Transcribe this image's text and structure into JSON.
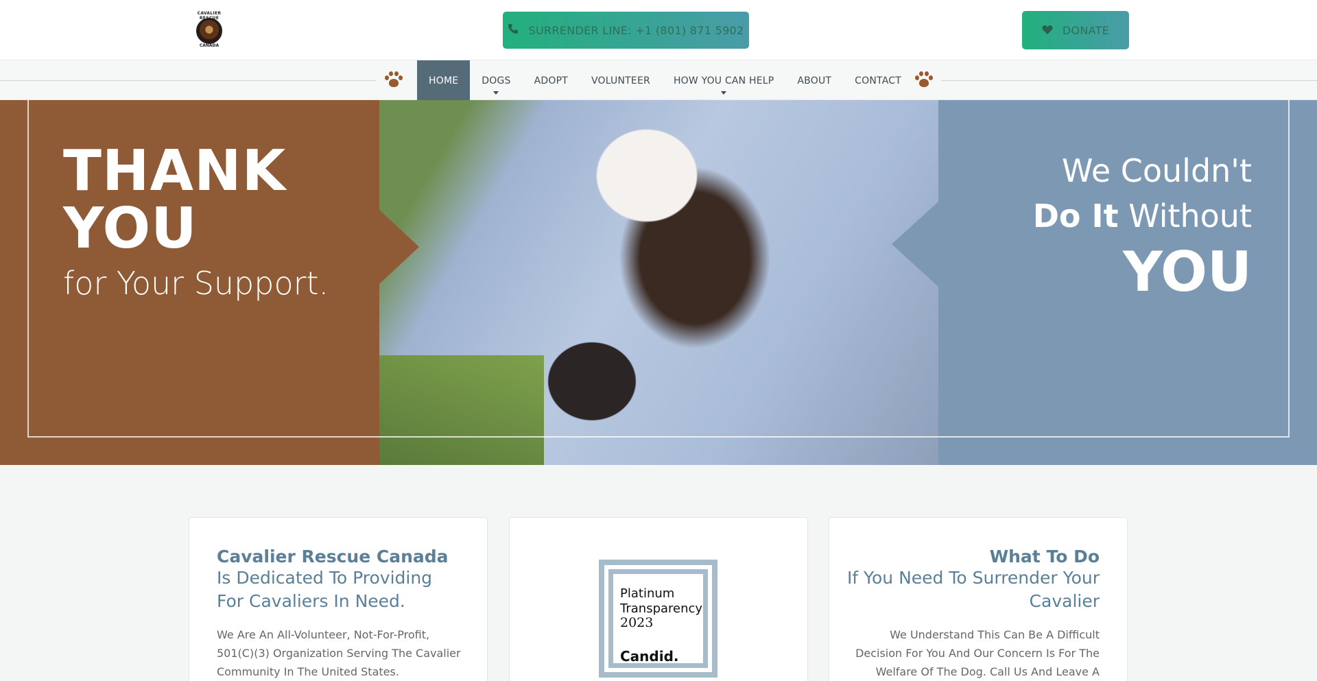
{
  "header": {
    "logo": {
      "text_top": "CAVALIER RESCUE",
      "text_bottom": "CANADA"
    },
    "surrender_button": {
      "icon": "phone-icon",
      "label": "SURRENDER LINE: +1 (801) 871 5902"
    },
    "donate_button": {
      "icon": "heart-icon",
      "label": "DONATE"
    }
  },
  "nav": {
    "items": [
      {
        "label": "HOME",
        "active": true
      },
      {
        "label": "DOGS",
        "dropdown": true
      },
      {
        "label": "ADOPT"
      },
      {
        "label": "VOLUNTEER"
      },
      {
        "label": "HOW YOU CAN HELP",
        "dropdown": true
      },
      {
        "label": "ABOUT"
      },
      {
        "label": "CONTACT"
      }
    ],
    "decor_icon": "paw-icon"
  },
  "hero": {
    "left_line1": "THANK",
    "left_line2": "YOU",
    "left_line3": "for Your Support.",
    "right_line1": "We Couldn't",
    "right_line2_bold": "Do It",
    "right_line2_rest": " Without",
    "right_line3": "YOU",
    "colors": {
      "left": "#8e5b36",
      "right": "#7d98b2"
    }
  },
  "cards": {
    "mission": {
      "title": "Cavalier Rescue Canada",
      "subtitle": "Is Dedicated To Providing For Cavaliers In Need.",
      "body": "We Are An All-Volunteer, Not-For-Profit, 501(C)(3) Organization Serving The Cavalier Community In The United States."
    },
    "badge": {
      "line1": "Platinum",
      "line2": "Transparency",
      "year": "2023",
      "brand": "Candid."
    },
    "surrender": {
      "title": "What To Do",
      "subtitle": "If You Need To Surrender Your Cavalier",
      "body": "We Understand This Can Be A Difficult Decision For You And Our Concern Is For The Welfare Of The Dog. Call Us And Leave A"
    }
  },
  "colors": {
    "accent": "#5a7f97",
    "nav_active": "#556b78",
    "cta": "#22b07d"
  }
}
